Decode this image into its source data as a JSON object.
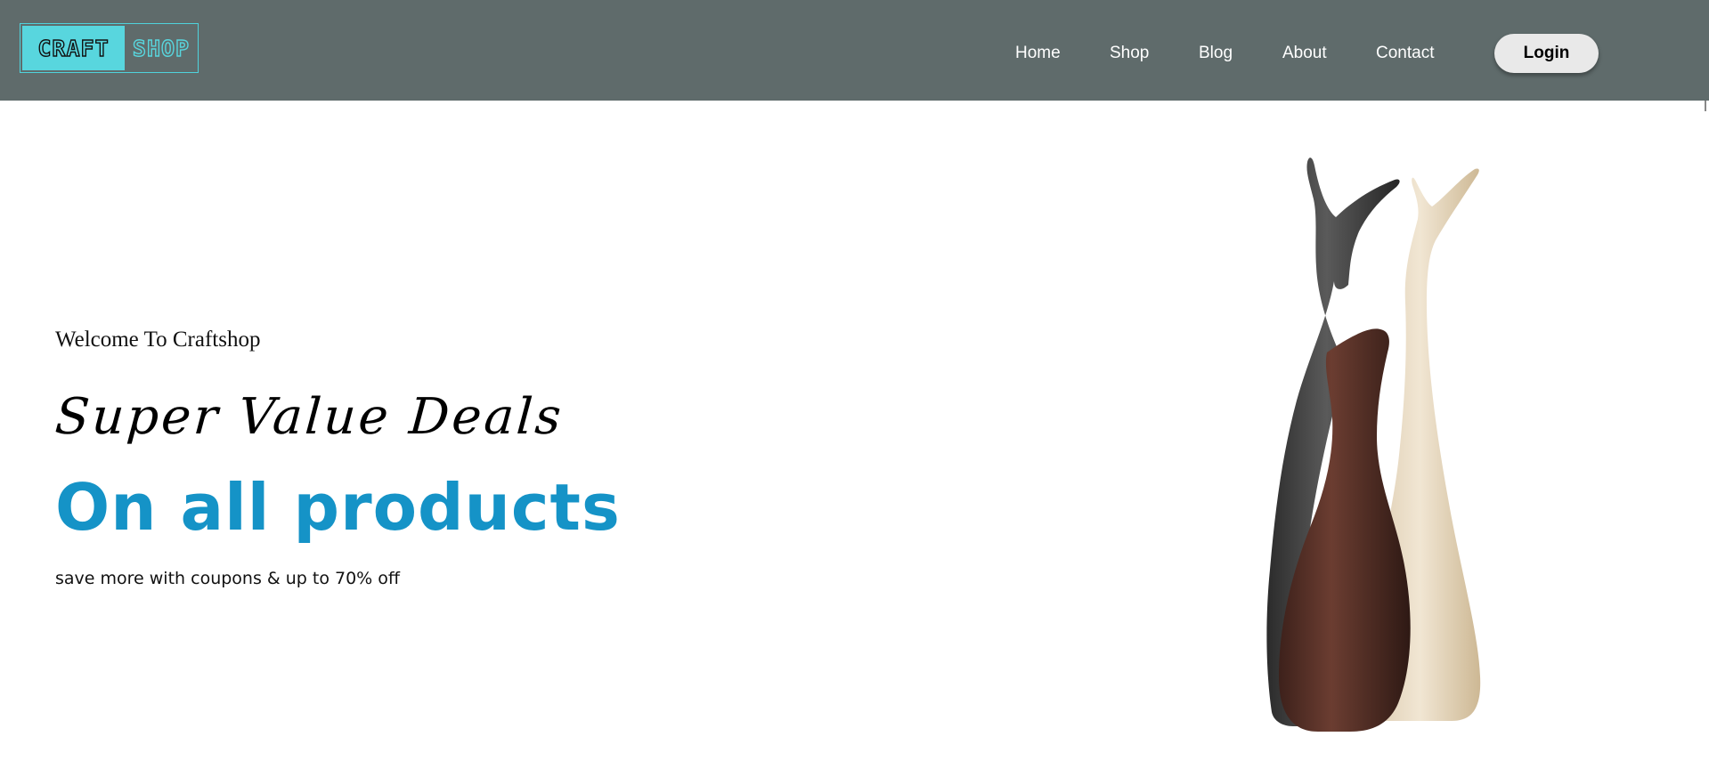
{
  "header": {
    "background": "#5f6b6b",
    "logo": {
      "part1": "CRAFT",
      "part2": "SHOP",
      "accent": "#58d6de"
    },
    "nav": [
      {
        "label": "Home"
      },
      {
        "label": "Shop"
      },
      {
        "label": "Blog"
      },
      {
        "label": "About"
      },
      {
        "label": "Contact"
      }
    ],
    "login_label": "Login"
  },
  "hero": {
    "welcome": "Welcome To Craftshop",
    "headline": "Super Value Deals",
    "subheadline": "On all products",
    "subheadline_color": "#1593c7",
    "tagline": "save more with coupons & up to 70% off",
    "image_icon": "ceramic-vases-image"
  }
}
